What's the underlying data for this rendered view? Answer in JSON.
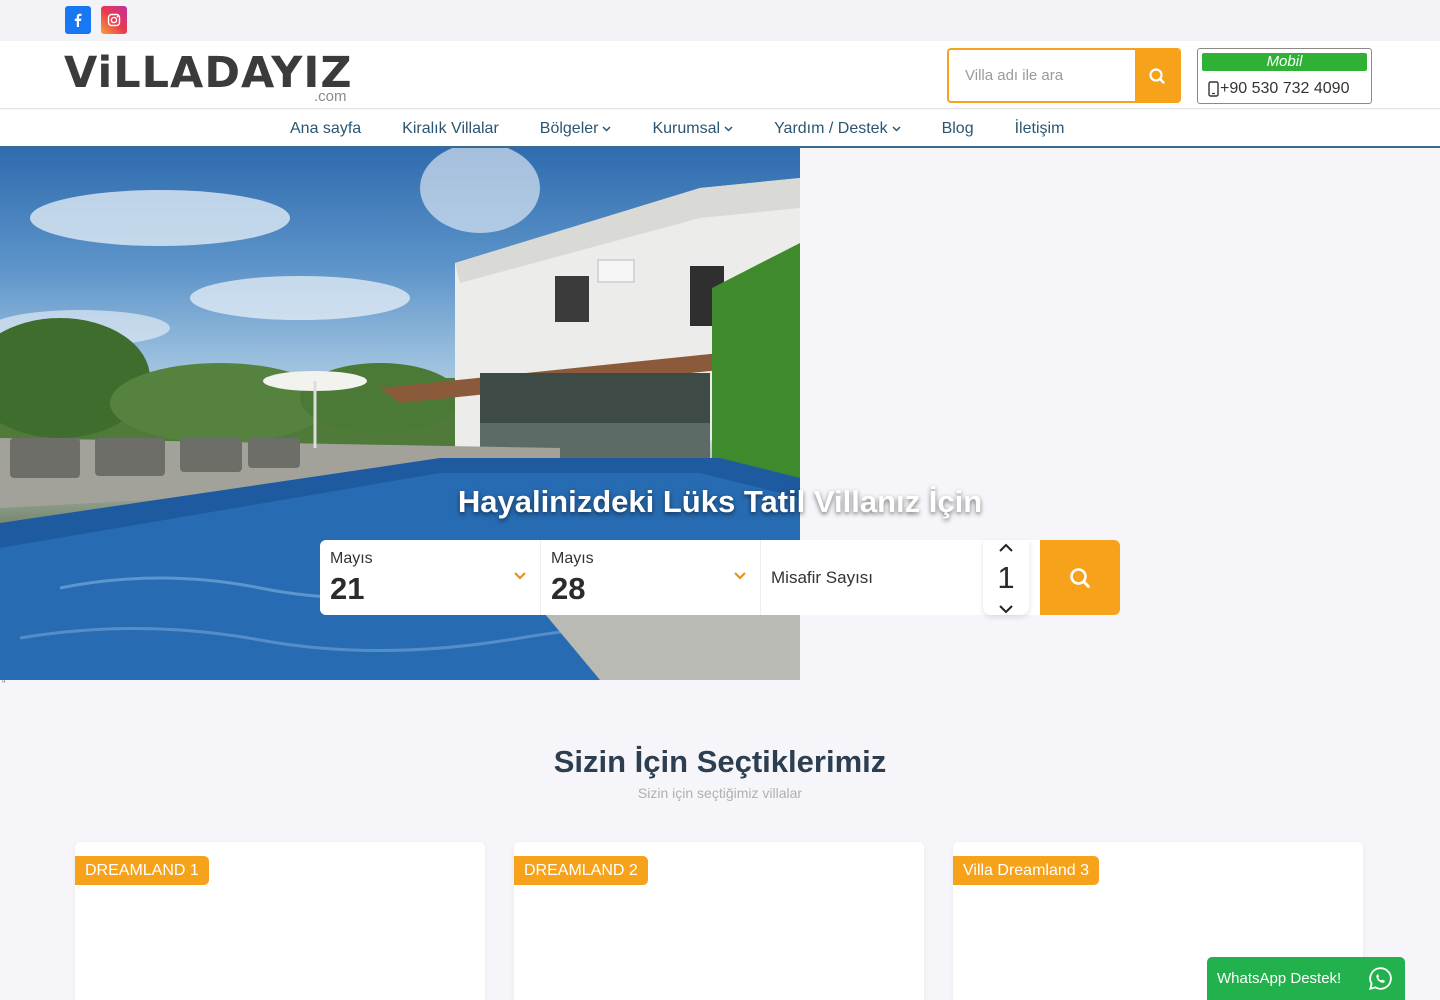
{
  "social": {
    "facebook_icon": "facebook-icon",
    "instagram_icon": "instagram-icon"
  },
  "header": {
    "logo_text": "ViLLADAYIZ",
    "logo_suffix": ".com",
    "search_placeholder": "Villa adı ile ara",
    "phone_label": "Mobil",
    "phone_number": "+90 530 732 4090"
  },
  "nav": {
    "items": [
      {
        "label": "Ana sayfa",
        "dropdown": false
      },
      {
        "label": "Kiralık Villalar",
        "dropdown": false
      },
      {
        "label": "Bölgeler",
        "dropdown": true
      },
      {
        "label": "Kurumsal",
        "dropdown": true
      },
      {
        "label": "Yardım / Destek",
        "dropdown": true
      },
      {
        "label": "Blog",
        "dropdown": false
      },
      {
        "label": "İletişim",
        "dropdown": false
      }
    ]
  },
  "hero": {
    "title": "Hayalinizdeki Lüks Tatil Villanız İçin"
  },
  "booking": {
    "checkin_month": "Mayıs",
    "checkin_day": "21",
    "checkout_month": "Mayıs",
    "checkout_day": "28",
    "guests_label": "Misafir Sayısı",
    "guests_count": "1"
  },
  "stray_text": "''",
  "section": {
    "title": "Sizin İçin Seçtiklerimiz",
    "subtitle": "Sizin için seçtiğimiz villalar"
  },
  "cards": [
    {
      "tag": "DREAMLAND 1"
    },
    {
      "tag": "DREAMLAND 2"
    },
    {
      "tag": "Villa Dreamland 3"
    }
  ],
  "whatsapp": {
    "label": "WhatsApp Destek!"
  },
  "colors": {
    "accent": "#f7a21b",
    "nav_text": "#2c5571",
    "mobile_badge": "#2eb135",
    "whatsapp": "#22b14c"
  }
}
